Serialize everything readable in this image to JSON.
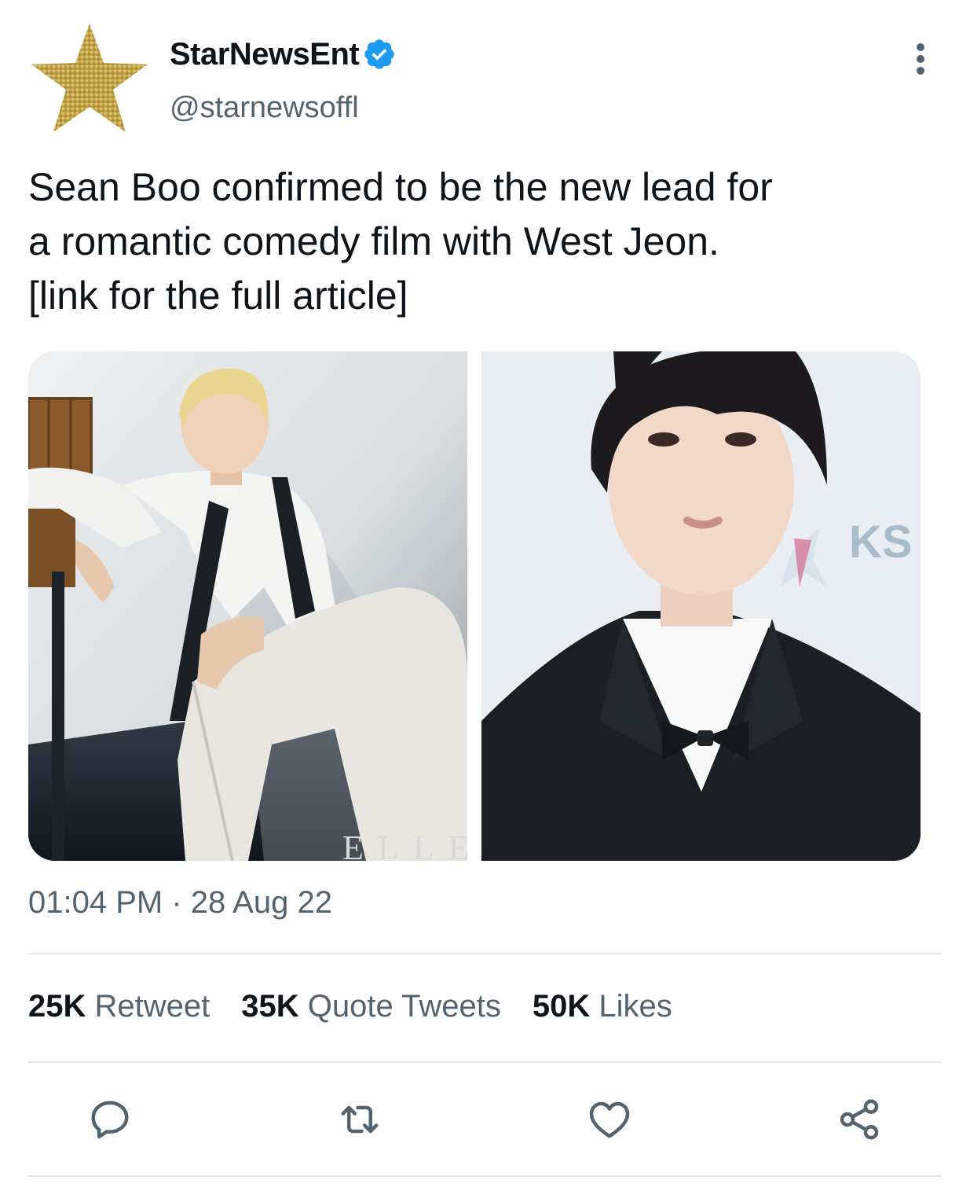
{
  "account": {
    "display_name": "StarNewsEnt",
    "handle": "@starnewsoffl",
    "verified_icon": "verified-badge-icon",
    "avatar_icon": "gold-star-icon"
  },
  "tweet": {
    "text_lines": [
      "Sean Boo confirmed to be the new lead for",
      "a romantic comedy film with West Jeon.",
      "[link for the full article]"
    ]
  },
  "media": {
    "left_watermark": "ELLE",
    "right_backdrop_text": "KS"
  },
  "meta": {
    "time": "01:04 PM",
    "separator": " · ",
    "date": "28 Aug 22"
  },
  "stats": {
    "retweets": {
      "count": "25K",
      "label": "Retweet"
    },
    "quotes": {
      "count": "35K",
      "label": "Quote Tweets"
    },
    "likes": {
      "count": "50K",
      "label": "Likes"
    }
  },
  "actions": {
    "reply_icon": "reply-icon",
    "retweet_icon": "retweet-icon",
    "like_icon": "heart-icon",
    "share_icon": "share-icon"
  },
  "colors": {
    "text_primary": "#0f1419",
    "text_secondary": "#536471",
    "verified_blue": "#1d9bf0",
    "star_gold": "#c9a74a",
    "divider": "#e4e7ea"
  }
}
